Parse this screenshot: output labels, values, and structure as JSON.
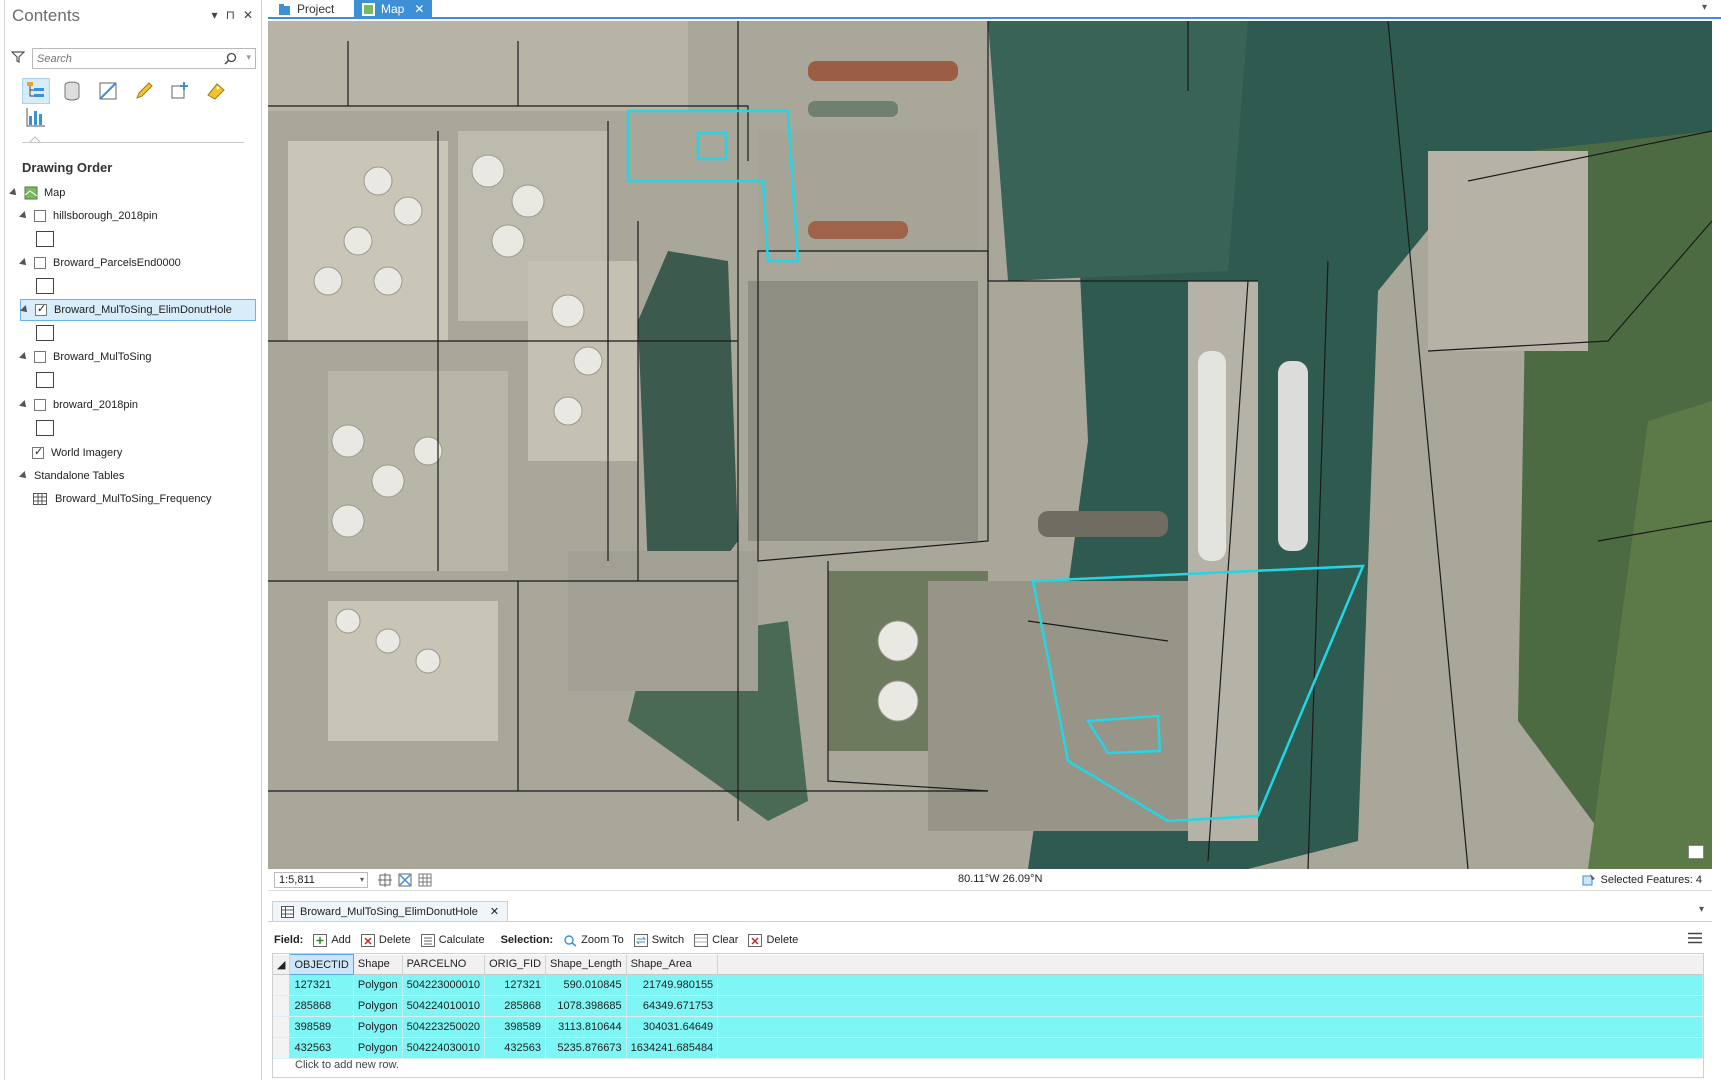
{
  "contents": {
    "title": "Contents",
    "ctrls": [
      "▾",
      "⊓",
      "✕"
    ],
    "search_placeholder": "Search",
    "section": "Drawing Order",
    "map_label": "Map",
    "layers": [
      {
        "name": "hillsborough_2018pin",
        "checked": false
      },
      {
        "name": "Broward_ParcelsEnd0000",
        "checked": false
      },
      {
        "name": "Broward_MulToSing_ElimDonutHole",
        "checked": true
      },
      {
        "name": "Broward_MulToSing",
        "checked": false
      },
      {
        "name": "broward_2018pin",
        "checked": false
      }
    ],
    "basemap": "World Imagery",
    "standalone": "Standalone Tables",
    "table_name": "Broward_MulToSing_Frequency"
  },
  "tabs": {
    "project": "Project",
    "map": "Map"
  },
  "status": {
    "scale": "1:5,811",
    "coords": "80.11°W 26.09°N",
    "selected": "Selected Features: 4"
  },
  "attr": {
    "tab": "Broward_MulToSing_ElimDonutHole",
    "field_label": "Field:",
    "field_add": "Add",
    "field_delete": "Delete",
    "field_calc": "Calculate",
    "selection_label": "Selection:",
    "zoom_to": "Zoom To",
    "switch": "Switch",
    "clear": "Clear",
    "sel_delete": "Delete",
    "columns": [
      "OBJECTID",
      "Shape",
      "PARCELNO",
      "ORIG_FID",
      "Shape_Length",
      "Shape_Area"
    ],
    "rows": [
      [
        "127321",
        "Polygon",
        "504223000010",
        "127321",
        "590.010845",
        "21749.980155"
      ],
      [
        "285868",
        "Polygon",
        "504224010010",
        "285868",
        "1078.398685",
        "64349.671753"
      ],
      [
        "398589",
        "Polygon",
        "504223250020",
        "398589",
        "3113.810644",
        "304031.64649"
      ],
      [
        "432563",
        "Polygon",
        "504224030010",
        "432563",
        "5235.876673",
        "1634241.685484"
      ]
    ],
    "new_row": "Click to add new row."
  },
  "colors": {
    "accent": "#3d8fd6",
    "selection": "#22d6e6",
    "row_highlight": "#7ff6f6",
    "water": "#2f5a4f"
  }
}
